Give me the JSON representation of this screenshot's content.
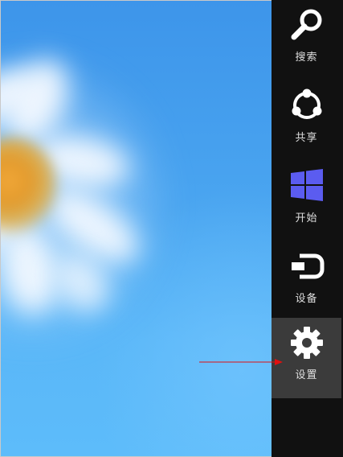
{
  "charms": {
    "items": [
      {
        "key": "search",
        "label": "搜索",
        "icon": "search-icon"
      },
      {
        "key": "share",
        "label": "共享",
        "icon": "share-icon"
      },
      {
        "key": "start",
        "label": "开始",
        "icon": "windows-logo-icon"
      },
      {
        "key": "devices",
        "label": "设备",
        "icon": "devices-icon"
      },
      {
        "key": "settings",
        "label": "设置",
        "icon": "settings-gear-icon",
        "active": true
      }
    ]
  },
  "colors": {
    "charm_bar": "#111111",
    "charm_active": "#3b3b3b",
    "wallpaper_blue": "#4aa5f0",
    "windows_logo": "#5b5cf0",
    "annotation_arrow": "#e01010"
  }
}
